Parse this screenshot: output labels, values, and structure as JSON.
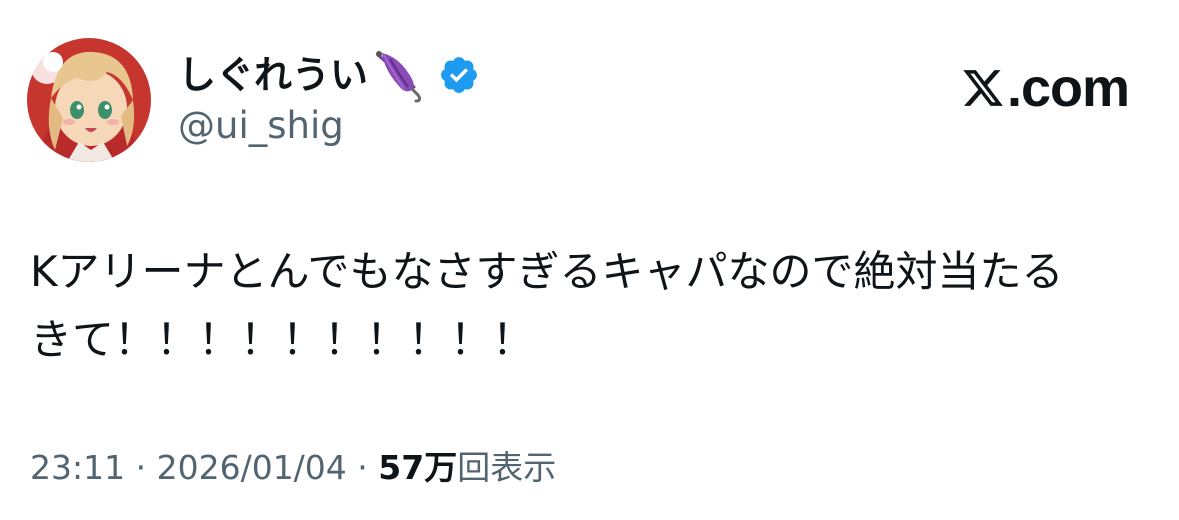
{
  "author": {
    "display_name": "しぐれうい",
    "name_emoji": "closed-umbrella-emoji",
    "verified_badge": "verified-badge-icon",
    "handle": "@ui_shig"
  },
  "brand": {
    "logo": "x-logo-icon",
    "text": ".com"
  },
  "tweet": {
    "line1": "Kアリーナとんでもなさすぎるキャパなので絶対当たる",
    "line2": "きて！！！！！！！！！！"
  },
  "meta": {
    "time": "23:11",
    "separator1": " · ",
    "date": "2026/01/04",
    "separator2": " · ",
    "views_count": "57万",
    "views_label": "回表示"
  },
  "colors": {
    "text": "#0f1419",
    "secondary": "#536471",
    "verified": "#1d9bf0",
    "umbrella": "#7b3fa0"
  }
}
